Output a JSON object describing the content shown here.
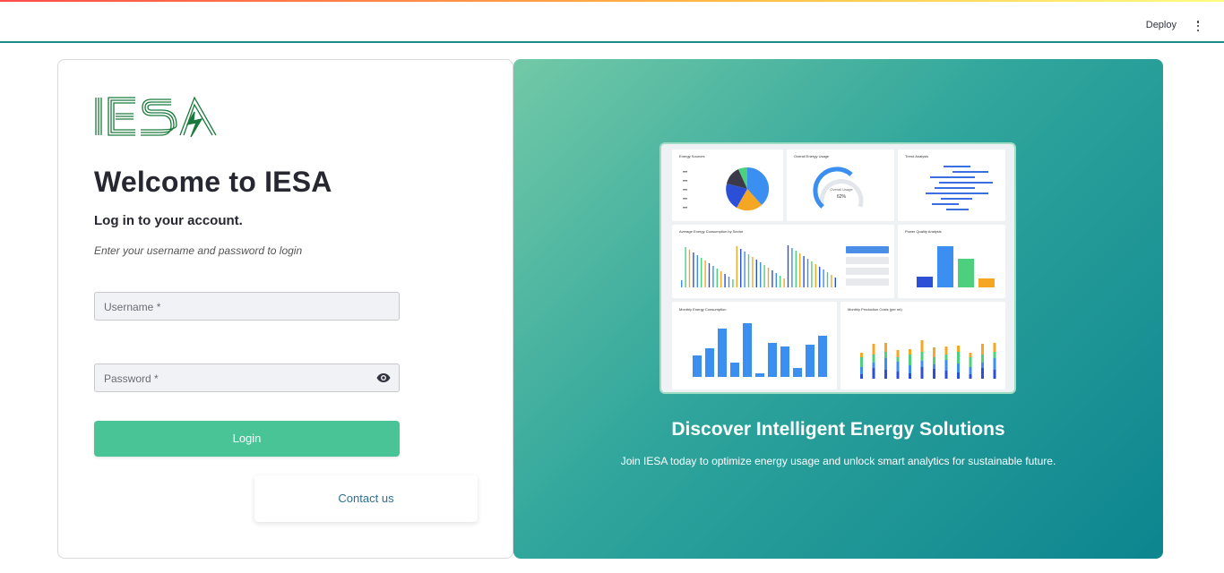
{
  "header": {
    "deploy_label": "Deploy"
  },
  "brand": {
    "logo_text": "IESA",
    "logo_color": "#1a7a3c"
  },
  "login": {
    "title": "Welcome to IESA",
    "subtitle": "Log in to your account.",
    "hint": "Enter your username and password to login",
    "username_placeholder": "Username *",
    "password_placeholder": "Password *",
    "login_label": "Login",
    "contact_label": "Contact us"
  },
  "promo": {
    "title": "Discover Intelligent Energy Solutions",
    "text": "Join IESA today to optimize energy usage and unlock smart analytics for sustainable future."
  },
  "dashboard_preview": {
    "panels": [
      "Energy Sources",
      "Overall Energy Usage",
      "Trend Analysis",
      "Average Energy Consumption by Sector",
      "Power Quality Analysis",
      "Monthly Energy Consumption",
      "Monthly Production Costs (per mt)"
    ],
    "gauge_label": "Overall Usage",
    "gauge_value": "62%"
  },
  "colors": {
    "accent": "#48c497",
    "header_line": "#1c8a8a",
    "panel_start": "#72c9a7",
    "panel_end": "#0d858f"
  }
}
